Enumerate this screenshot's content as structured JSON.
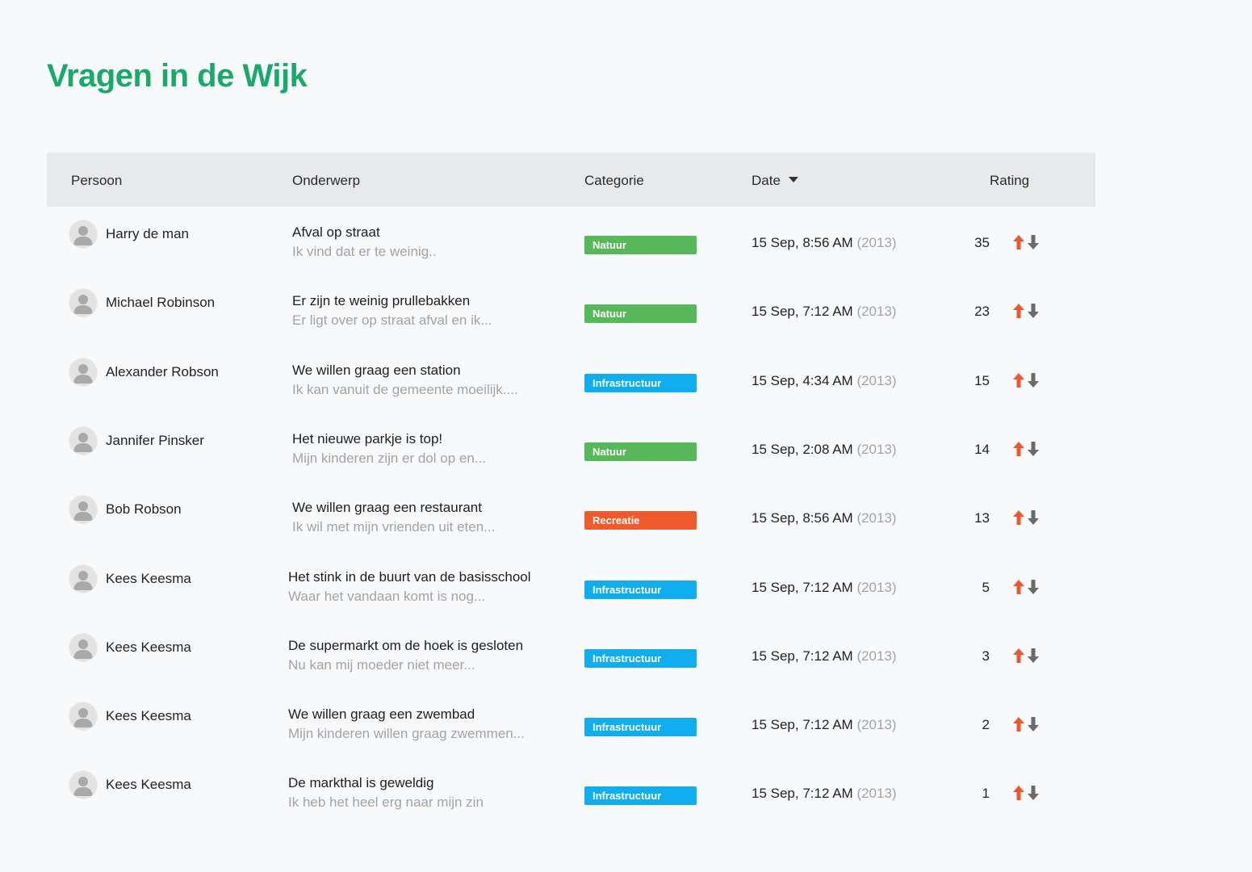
{
  "page": {
    "title": "Vragen in de Wijk"
  },
  "colors": {
    "title": "#1aa96a",
    "categories": {
      "Natuur": "#57b85a",
      "Infrastructuur": "#10aeee",
      "Recreatie": "#f05a2c"
    },
    "upvote": "#f0552b",
    "downvote": "#6b6b6b"
  },
  "table": {
    "headers": {
      "person": "Persoon",
      "subject": "Onderwerp",
      "category": "Categorie",
      "date": "Date",
      "rating": "Rating"
    },
    "sort": {
      "column": "Date",
      "icon": "caret-down-icon"
    },
    "rows": [
      {
        "person": "Harry de man",
        "subject": "Afval op straat",
        "snippet": "Ik vind dat er te weinig..",
        "category": "Natuur",
        "date": "15 Sep, 8:56 AM",
        "year": "(2013)",
        "rating": "35"
      },
      {
        "person": "Michael Robinson",
        "subject": "Er zijn te weinig prullebakken",
        "snippet": "Er ligt over op straat afval en ik...",
        "category": "Natuur",
        "date": "15 Sep, 7:12 AM",
        "year": "(2013)",
        "rating": "23"
      },
      {
        "person": "Alexander Robson",
        "subject": "We willen graag een station",
        "snippet": "Ik kan vanuit de gemeente moeilijk....",
        "category": "Infrastructuur",
        "date": "15 Sep, 4:34 AM",
        "year": "(2013)",
        "rating": "15"
      },
      {
        "person": "Jannifer Pinsker",
        "subject": "Het nieuwe parkje is top!",
        "snippet": "Mijn kinderen zijn er dol op en...",
        "category": "Natuur",
        "date": "15 Sep, 2:08 AM",
        "year": "(2013)",
        "rating": "14"
      },
      {
        "person": "Bob Robson",
        "subject": "We willen graag een restaurant",
        "snippet": "Ik wil met mijn vrienden uit eten...",
        "category": "Recreatie",
        "date": "15 Sep, 8:56 AM",
        "year": "(2013)",
        "rating": "13"
      },
      {
        "person": "Kees Keesma",
        "subject": "Het stink in de buurt van de basisschool",
        "snippet": "Waar het vandaan komt is nog...",
        "category": "Infrastructuur",
        "date": "15 Sep, 7:12 AM",
        "year": "(2013)",
        "rating": "5"
      },
      {
        "person": "Kees Keesma",
        "subject": "De supermarkt om de hoek is gesloten",
        "snippet": "Nu kan mij moeder niet meer...",
        "category": "Infrastructuur",
        "date": "15 Sep, 7:12 AM",
        "year": "(2013)",
        "rating": "3"
      },
      {
        "person": "Kees Keesma",
        "subject": "We willen graag een zwembad",
        "snippet": "Mijn kinderen willen graag zwemmen...",
        "category": "Infrastructuur",
        "date": "15 Sep, 7:12 AM",
        "year": "(2013)",
        "rating": "2"
      },
      {
        "person": "Kees Keesma",
        "subject": "De markthal is geweldig",
        "snippet": "Ik heb het heel erg naar mijn zin",
        "category": "Infrastructuur",
        "date": "15 Sep, 7:12 AM",
        "year": "(2013)",
        "rating": "1"
      }
    ]
  }
}
